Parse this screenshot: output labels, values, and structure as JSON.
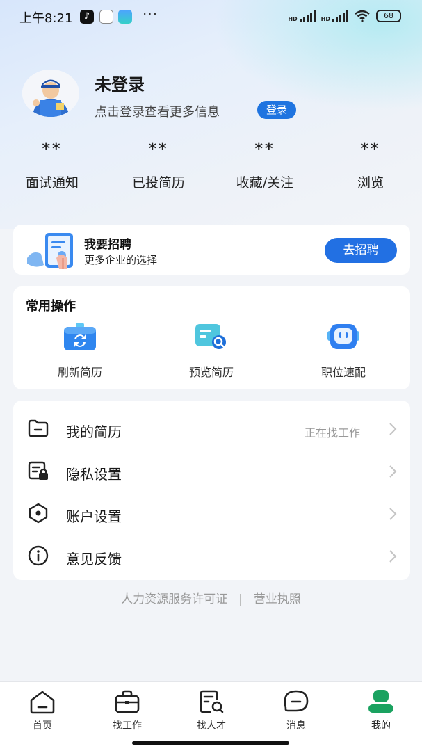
{
  "status_bar": {
    "time": "上午8:21",
    "more": "···",
    "battery": "68",
    "hd1": "HD",
    "hd2": "HD"
  },
  "profile": {
    "name": "未登录",
    "subtitle": "点击登录查看更多信息",
    "login_label": "登录"
  },
  "stats": [
    {
      "value": "**",
      "label": "面试通知"
    },
    {
      "value": "**",
      "label": "已投简历"
    },
    {
      "value": "**",
      "label": "收藏/关注"
    },
    {
      "value": "**",
      "label": "浏览"
    }
  ],
  "recruit": {
    "title": "我要招聘",
    "subtitle": "更多企业的选择",
    "button": "去招聘"
  },
  "common_ops": {
    "title": "常用操作",
    "items": [
      {
        "label": "刷新简历",
        "icon": "refresh-resume-icon"
      },
      {
        "label": "预览简历",
        "icon": "preview-resume-icon"
      },
      {
        "label": "职位速配",
        "icon": "job-match-icon"
      }
    ]
  },
  "menu": {
    "items": [
      {
        "label": "我的简历",
        "value": "正在找工作",
        "icon": "folder-icon"
      },
      {
        "label": "隐私设置",
        "value": "",
        "icon": "privacy-lock-icon"
      },
      {
        "label": "账户设置",
        "value": "",
        "icon": "hexagon-settings-icon"
      },
      {
        "label": "意见反馈",
        "value": "",
        "icon": "info-icon"
      }
    ]
  },
  "footer": {
    "license": "人力资源服务许可证",
    "separator": "|",
    "business": "营业执照"
  },
  "bottom_nav": {
    "items": [
      {
        "label": "首页",
        "icon": "home-icon"
      },
      {
        "label": "找工作",
        "icon": "briefcase-icon"
      },
      {
        "label": "找人才",
        "icon": "talent-search-icon"
      },
      {
        "label": "消息",
        "icon": "message-icon"
      },
      {
        "label": "我的",
        "icon": "profile-icon",
        "active": true
      }
    ]
  },
  "colors": {
    "primary": "#2270e3",
    "active_nav": "#1aa260"
  }
}
